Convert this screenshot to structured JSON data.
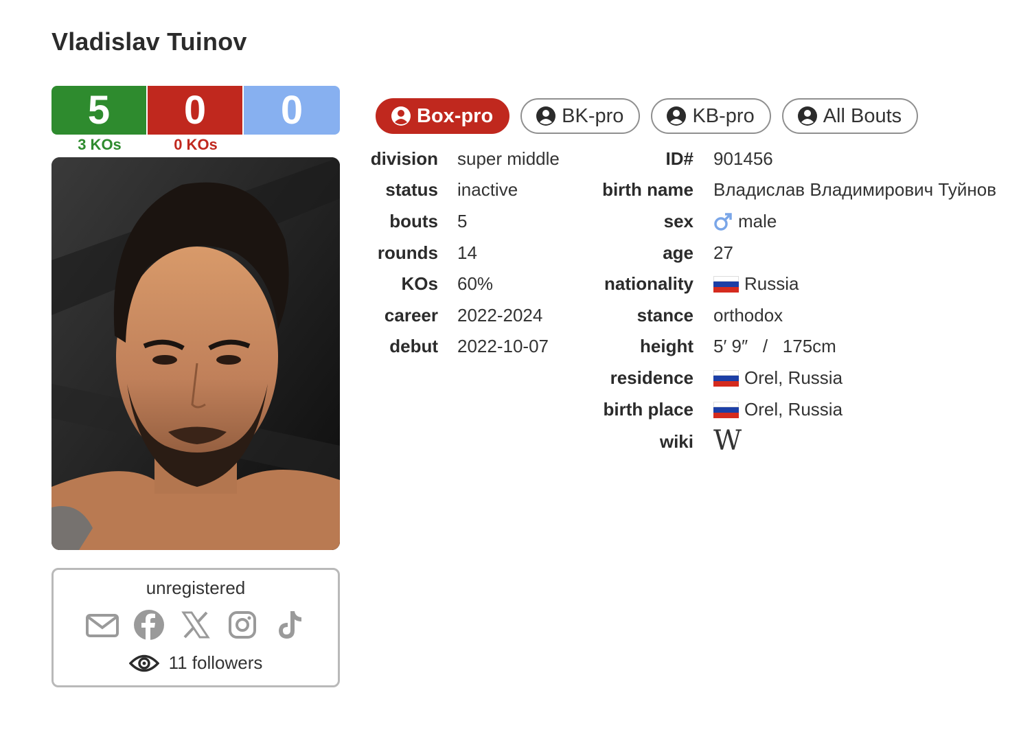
{
  "fighter": {
    "name": "Vladislav Tuinov"
  },
  "record": {
    "wins": "5",
    "losses": "0",
    "draws": "0",
    "win_kos": "3 KOs",
    "loss_kos": "0 KOs"
  },
  "colors": {
    "win": "#2e8b2e",
    "loss": "#c0281e",
    "draw": "#87b0f0",
    "wiki": "#1a47c4"
  },
  "tabs": [
    {
      "label": "Box-pro",
      "active": true,
      "icon": "user-circle-icon"
    },
    {
      "label": "BK-pro",
      "active": false,
      "icon": "user-circle-icon"
    },
    {
      "label": "KB-pro",
      "active": false,
      "icon": "user-circle-icon"
    },
    {
      "label": "All Bouts",
      "active": false,
      "icon": "user-circle-icon"
    }
  ],
  "left_info": [
    {
      "label": "division",
      "value": "super middle"
    },
    {
      "label": "status",
      "value": "inactive"
    },
    {
      "label": "bouts",
      "value": "5"
    },
    {
      "label": "rounds",
      "value": "14"
    },
    {
      "label": "KOs",
      "value": "60%"
    },
    {
      "label": "career",
      "value": "2022-2024"
    },
    {
      "label": "debut",
      "value": "2022-10-07"
    }
  ],
  "right_info": [
    {
      "label": "ID#",
      "value": "901456"
    },
    {
      "label": "birth name",
      "value": "Владислав Владимирович Туйнов"
    },
    {
      "label": "sex",
      "value": "male",
      "icon": "male-symbol-icon"
    },
    {
      "label": "age",
      "value": "27"
    },
    {
      "label": "nationality",
      "value": "Russia",
      "icon": "russia-flag-icon"
    },
    {
      "label": "stance",
      "value": "orthodox"
    },
    {
      "label": "height",
      "value": "5′ 9″   /   175cm"
    },
    {
      "label": "residence",
      "value": "Orel, Russia",
      "icon": "russia-flag-icon"
    },
    {
      "label": "birth place",
      "value": "Orel, Russia",
      "icon": "russia-flag-icon"
    },
    {
      "label": "wiki",
      "value": "W",
      "icon": "wikipedia-icon"
    }
  ],
  "social": {
    "status": "unregistered",
    "icons": [
      "envelope-icon",
      "facebook-icon",
      "x-icon",
      "instagram-icon",
      "tiktok-icon"
    ],
    "followers": "11 followers"
  }
}
